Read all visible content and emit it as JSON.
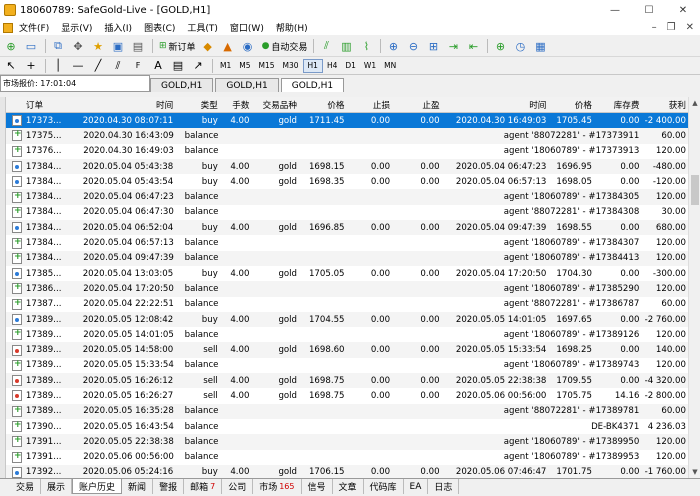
{
  "window": {
    "title": "18060789: SafeGold-Live - [GOLD,H1]",
    "minimize": "—",
    "maximize": "☐",
    "close": "✕"
  },
  "menu": [
    "文件(F)",
    "显示(V)",
    "插入(I)",
    "图表(C)",
    "工具(T)",
    "窗口(W)",
    "帮助(H)"
  ],
  "toolbar": {
    "new_order": "新订单",
    "auto_trade": "自动交易"
  },
  "timeframes": [
    "M1",
    "M5",
    "M15",
    "M30",
    "H1",
    "H4",
    "D1",
    "W1",
    "MN"
  ],
  "active_timeframe": "H1",
  "market_time": "市场报价: 17:01:04",
  "chart_tabs": [
    "GOLD,H1",
    "GOLD,H1",
    "GOLD,H1"
  ],
  "active_chart_tab": 2,
  "columns": [
    "订单",
    "时间",
    "类型",
    "手数",
    "交易品种",
    "价格",
    "止损",
    "止盈",
    "时间",
    "价格",
    "库存费",
    "获利"
  ],
  "rows": [
    {
      "order": "17373...",
      "time": "2020.04.30 08:07:11",
      "type": "buy",
      "lots": "4.00",
      "symbol": "gold",
      "price": "1711.45",
      "sl": "0.00",
      "tp": "0.00",
      "close_time": "2020.04.30 16:49:03",
      "close_price": "1705.45",
      "swap": "0.00",
      "profit": "-2 400.00"
    },
    {
      "order": "17375...",
      "time": "2020.04.30 16:43:09",
      "type": "balance",
      "comment": "agent '88072281' - #17373911",
      "profit": "60.00"
    },
    {
      "order": "17376...",
      "time": "2020.04.30 16:49:03",
      "type": "balance",
      "comment": "agent '18060789' - #17373913",
      "profit": "120.00"
    },
    {
      "order": "17384...",
      "time": "2020.05.04 05:43:38",
      "type": "buy",
      "lots": "4.00",
      "symbol": "gold",
      "price": "1698.15",
      "sl": "0.00",
      "tp": "0.00",
      "close_time": "2020.05.04 06:47:23",
      "close_price": "1696.95",
      "swap": "0.00",
      "profit": "-480.00"
    },
    {
      "order": "17384...",
      "time": "2020.05.04 05:43:54",
      "type": "buy",
      "lots": "4.00",
      "symbol": "gold",
      "price": "1698.35",
      "sl": "0.00",
      "tp": "0.00",
      "close_time": "2020.05.04 06:57:13",
      "close_price": "1698.05",
      "swap": "0.00",
      "profit": "-120.00"
    },
    {
      "order": "17384...",
      "time": "2020.05.04 06:47:23",
      "type": "balance",
      "comment": "agent '18060789' - #17384305",
      "profit": "120.00"
    },
    {
      "order": "17384...",
      "time": "2020.05.04 06:47:30",
      "type": "balance",
      "comment": "agent '88072281' - #17384308",
      "profit": "30.00"
    },
    {
      "order": "17384...",
      "time": "2020.05.04 06:52:04",
      "type": "buy",
      "lots": "4.00",
      "symbol": "gold",
      "price": "1696.85",
      "sl": "0.00",
      "tp": "0.00",
      "close_time": "2020.05.04 09:47:39",
      "close_price": "1698.55",
      "swap": "0.00",
      "profit": "680.00"
    },
    {
      "order": "17384...",
      "time": "2020.05.04 06:57:13",
      "type": "balance",
      "comment": "agent '18060789' - #17384307",
      "profit": "120.00"
    },
    {
      "order": "17384...",
      "time": "2020.05.04 09:47:39",
      "type": "balance",
      "comment": "agent '18060789' - #17384413",
      "profit": "120.00"
    },
    {
      "order": "17385...",
      "time": "2020.05.04 13:03:05",
      "type": "buy",
      "lots": "4.00",
      "symbol": "gold",
      "price": "1705.05",
      "sl": "0.00",
      "tp": "0.00",
      "close_time": "2020.05.04 17:20:50",
      "close_price": "1704.30",
      "swap": "0.00",
      "profit": "-300.00"
    },
    {
      "order": "17386...",
      "time": "2020.05.04 17:20:50",
      "type": "balance",
      "comment": "agent '18060789' - #17385290",
      "profit": "120.00"
    },
    {
      "order": "17387...",
      "time": "2020.05.04 22:22:51",
      "type": "balance",
      "comment": "agent '88072281' - #17386787",
      "profit": "60.00"
    },
    {
      "order": "17389...",
      "time": "2020.05.05 12:08:42",
      "type": "buy",
      "lots": "4.00",
      "symbol": "gold",
      "price": "1704.55",
      "sl": "0.00",
      "tp": "0.00",
      "close_time": "2020.05.05 14:01:05",
      "close_price": "1697.65",
      "swap": "0.00",
      "profit": "-2 760.00"
    },
    {
      "order": "17389...",
      "time": "2020.05.05 14:01:05",
      "type": "balance",
      "comment": "agent '18060789' - #17389126",
      "profit": "120.00"
    },
    {
      "order": "17389...",
      "time": "2020.05.05 14:58:00",
      "type": "sell",
      "lots": "4.00",
      "symbol": "gold",
      "price": "1698.60",
      "sl": "0.00",
      "tp": "0.00",
      "close_time": "2020.05.05 15:33:54",
      "close_price": "1698.25",
      "swap": "0.00",
      "profit": "140.00"
    },
    {
      "order": "17389...",
      "time": "2020.05.05 15:33:54",
      "type": "balance",
      "comment": "agent '18060789' - #17389743",
      "profit": "120.00"
    },
    {
      "order": "17389...",
      "time": "2020.05.05 16:26:12",
      "type": "sell",
      "lots": "4.00",
      "symbol": "gold",
      "price": "1698.75",
      "sl": "0.00",
      "tp": "0.00",
      "close_time": "2020.05.05 22:38:38",
      "close_price": "1709.55",
      "swap": "0.00",
      "profit": "-4 320.00"
    },
    {
      "order": "17389...",
      "time": "2020.05.05 16:26:27",
      "type": "sell",
      "lots": "4.00",
      "symbol": "gold",
      "price": "1698.75",
      "sl": "0.00",
      "tp": "0.00",
      "close_time": "2020.05.06 00:56:00",
      "close_price": "1705.75",
      "swap": "14.16",
      "profit": "-2 800.00"
    },
    {
      "order": "17389...",
      "time": "2020.05.05 16:35:28",
      "type": "balance",
      "comment": "agent '88072281' - #17389781",
      "profit": "60.00"
    },
    {
      "order": "17390...",
      "time": "2020.05.05 16:43:54",
      "type": "balance",
      "comment": "DE-BK4371",
      "profit": "4 236.03"
    },
    {
      "order": "17391...",
      "time": "2020.05.05 22:38:38",
      "type": "balance",
      "comment": "agent '18060789' - #17389950",
      "profit": "120.00"
    },
    {
      "order": "17391...",
      "time": "2020.05.06 00:56:00",
      "type": "balance",
      "comment": "agent '18060789' - #17389953",
      "profit": "120.00"
    },
    {
      "order": "17392...",
      "time": "2020.05.06 05:24:16",
      "type": "buy",
      "lots": "4.00",
      "symbol": "gold",
      "price": "1706.15",
      "sl": "0.00",
      "tp": "0.00",
      "close_time": "2020.05.06 07:46:47",
      "close_price": "1701.75",
      "swap": "0.00",
      "profit": "-1 760.00"
    }
  ],
  "selected_row": 0,
  "bottom_tabs": [
    {
      "label": "交易"
    },
    {
      "label": "展示"
    },
    {
      "label": "账户历史"
    },
    {
      "label": "新闻"
    },
    {
      "label": "警报"
    },
    {
      "label": "邮箱",
      "count": "7"
    },
    {
      "label": "公司"
    },
    {
      "label": "市场",
      "count": "165"
    },
    {
      "label": "信号"
    },
    {
      "label": "文章"
    },
    {
      "label": "代码库"
    },
    {
      "label": "EA"
    },
    {
      "label": "日志"
    }
  ],
  "active_bottom_tab": 2,
  "colors": {
    "selection": "#0a78d7",
    "alt_row": "#f4f4f4",
    "count_red": "#d00000"
  }
}
